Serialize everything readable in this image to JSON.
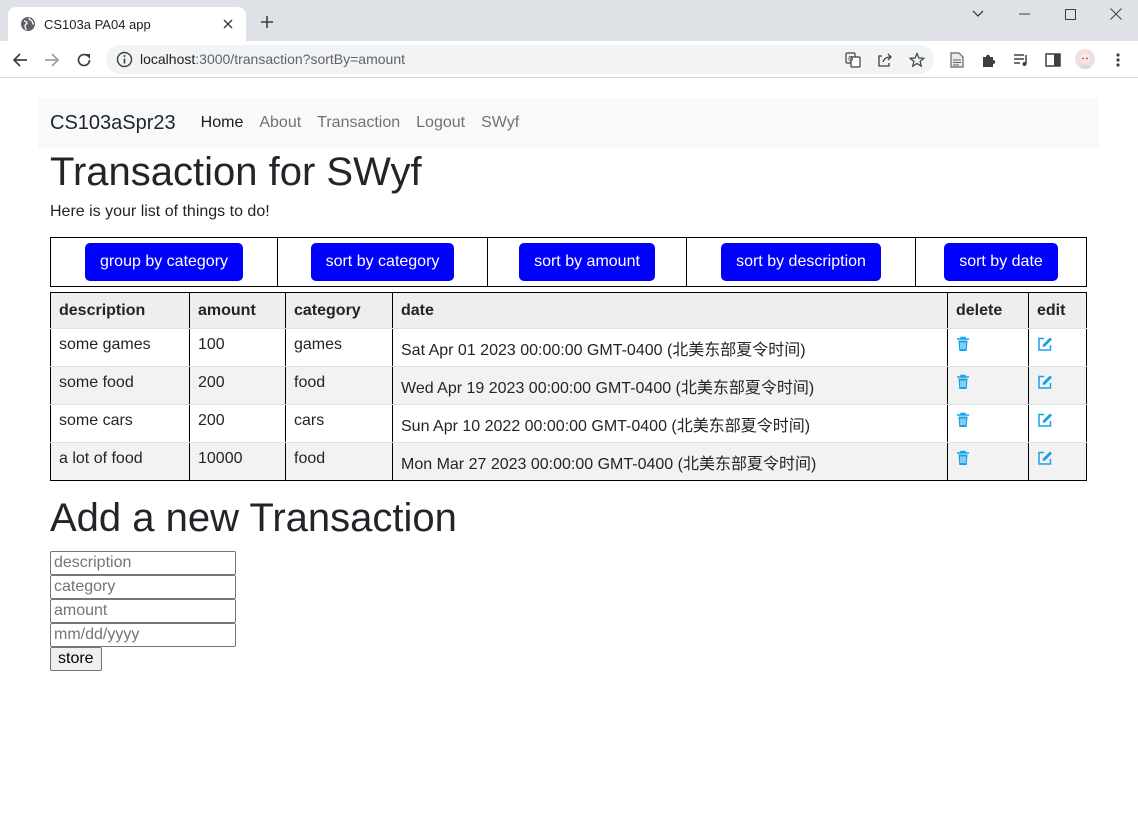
{
  "browser": {
    "tab_title": "CS103a PA04 app",
    "url_host": "localhost",
    "url_rest": ":3000/transaction?sortBy=amount"
  },
  "navbar": {
    "brand": "CS103aSpr23",
    "links": [
      "Home",
      "About",
      "Transaction",
      "Logout",
      "SWyf"
    ]
  },
  "page": {
    "title": "Transaction for SWyf",
    "subtitle": "Here is your list of things to do!"
  },
  "sort_buttons": [
    "group by category",
    "sort by category",
    "sort by amount",
    "sort by description",
    "sort by date"
  ],
  "table": {
    "headers": [
      "description",
      "amount",
      "category",
      "date",
      "delete",
      "edit"
    ],
    "rows": [
      {
        "description": "some games",
        "amount": "100",
        "category": "games",
        "date": "Sat Apr 01 2023 00:00:00 GMT-0400 (北美东部夏令时间)"
      },
      {
        "description": "some food",
        "amount": "200",
        "category": "food",
        "date": "Wed Apr 19 2023 00:00:00 GMT-0400 (北美东部夏令时间)"
      },
      {
        "description": "some cars",
        "amount": "200",
        "category": "cars",
        "date": "Sun Apr 10 2022 00:00:00 GMT-0400 (北美东部夏令时间)"
      },
      {
        "description": "a lot of food",
        "amount": "10000",
        "category": "food",
        "date": "Mon Mar 27 2023 00:00:00 GMT-0400 (北美东部夏令时间)"
      }
    ]
  },
  "add_form": {
    "title": "Add a new Transaction",
    "description_placeholder": "description",
    "category_placeholder": "category",
    "amount_placeholder": "amount",
    "date_placeholder": "mm/dd/yyyy",
    "submit_label": "store"
  },
  "colors": {
    "button_blue": "#0000ff",
    "icon_blue": "#17a2e8"
  },
  "icons": [
    "globe-icon",
    "close-icon",
    "plus-icon",
    "back-icon",
    "forward-icon",
    "reload-icon",
    "info-icon",
    "translate-icon",
    "share-icon",
    "star-icon",
    "document-icon",
    "puzzle-icon",
    "media-icon",
    "sidepanel-icon",
    "menu-icon",
    "trash-icon",
    "edit-icon"
  ]
}
